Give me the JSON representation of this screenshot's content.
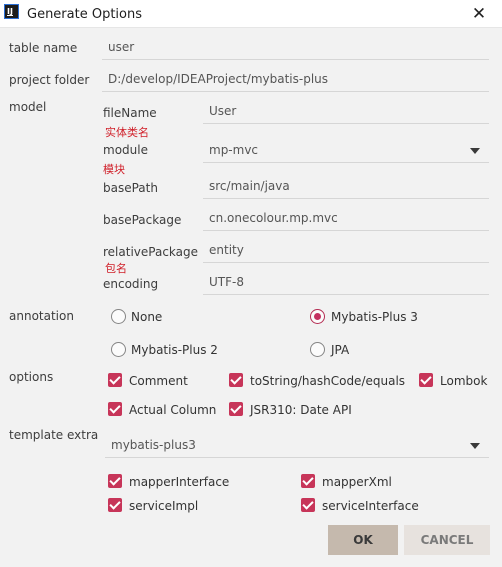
{
  "window": {
    "app_icon_text": "IJ",
    "title": "Generate Options",
    "close_icon": "close-icon"
  },
  "table_name": {
    "label": "table name",
    "value": "user"
  },
  "project_folder": {
    "label": "project folder",
    "value": "D:/develop/IDEAProject/mybatis-plus"
  },
  "model": {
    "label": "model",
    "fileName": {
      "label": "fileName",
      "value": "User",
      "note": "实体类名"
    },
    "module": {
      "label": "module",
      "value": "mp-mvc",
      "note": "模块"
    },
    "basePath": {
      "label": "basePath",
      "value": "src/main/java"
    },
    "basePackage": {
      "label": "basePackage",
      "value": "cn.onecolour.mp.mvc"
    },
    "relativePackage": {
      "label": "relativePackage",
      "value": "entity",
      "note": "包名"
    },
    "encoding": {
      "label": "encoding",
      "value": "UTF-8"
    }
  },
  "annotation": {
    "label": "annotation",
    "options": [
      {
        "label": "None",
        "selected": false
      },
      {
        "label": "Mybatis-Plus 3",
        "selected": true
      },
      {
        "label": "Mybatis-Plus 2",
        "selected": false
      },
      {
        "label": "JPA",
        "selected": false
      }
    ]
  },
  "options": {
    "label": "options",
    "items": [
      {
        "label": "Comment",
        "checked": true
      },
      {
        "label": "toString/hashCode/equals",
        "checked": true
      },
      {
        "label": "Lombok",
        "checked": true
      },
      {
        "label": "Actual Column",
        "checked": true
      },
      {
        "label": "JSR310: Date API",
        "checked": true
      }
    ]
  },
  "template_extra": {
    "label": "template extra",
    "value": "mybatis-plus3",
    "items": [
      {
        "label": "mapperInterface",
        "checked": true
      },
      {
        "label": "mapperXml",
        "checked": true
      },
      {
        "label": "serviceImpl",
        "checked": true
      },
      {
        "label": "serviceInterface",
        "checked": true
      }
    ]
  },
  "buttons": {
    "ok": "OK",
    "cancel": "CANCEL"
  },
  "colors": {
    "accent": "#c73559",
    "note": "#d0202a"
  }
}
